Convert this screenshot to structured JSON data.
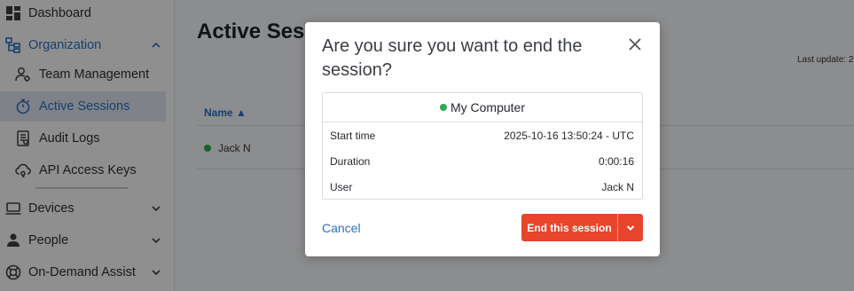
{
  "sidebar": {
    "items": [
      {
        "label": "Dashboard",
        "icon": "dashboard-icon"
      },
      {
        "label": "Organization",
        "icon": "organization-icon"
      },
      {
        "label": "Team Management",
        "icon": "team-management-icon"
      },
      {
        "label": "Active Sessions",
        "icon": "active-sessions-icon"
      },
      {
        "label": "Audit Logs",
        "icon": "audit-logs-icon"
      },
      {
        "label": "API Access Keys",
        "icon": "api-keys-icon"
      },
      {
        "label": "Devices",
        "icon": "devices-icon"
      },
      {
        "label": "People",
        "icon": "people-icon"
      },
      {
        "label": "On-Demand Assist",
        "icon": "on-demand-assist-icon"
      }
    ]
  },
  "main": {
    "title": "Active Sess",
    "last_update": "Last update: 2",
    "table": {
      "column_name": "Name ▲",
      "rows": [
        {
          "name": "Jack N",
          "status": "online"
        }
      ]
    }
  },
  "modal": {
    "title": "Are you sure you want to end the session?",
    "device": "My Computer",
    "details": [
      {
        "label": "Start time",
        "value": "2025-10-16 13:50:24 - UTC"
      },
      {
        "label": "Duration",
        "value": "0:00:16"
      },
      {
        "label": "User",
        "value": "Jack N"
      }
    ],
    "cancel_label": "Cancel",
    "end_label": "End this session"
  },
  "colors": {
    "accent_blue": "#2d6fc3",
    "danger": "#e8452c",
    "online": "#2fa84f"
  }
}
